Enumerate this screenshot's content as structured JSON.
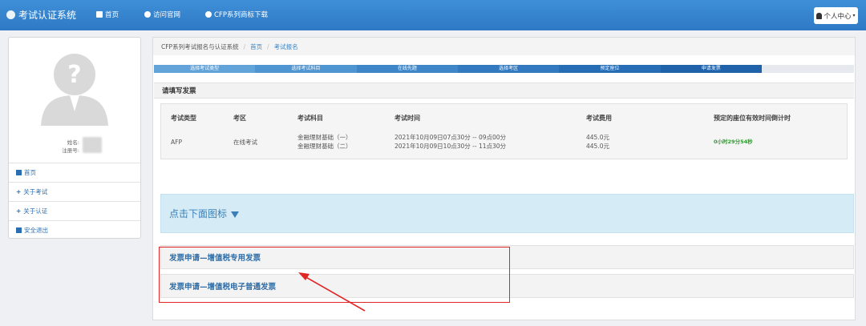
{
  "header": {
    "app_title": "考试认证系统",
    "nav": [
      {
        "label": "首页",
        "icon": "home-icon"
      },
      {
        "label": "访问官网",
        "icon": "globe-icon"
      },
      {
        "label": "CFP系列商标下载",
        "icon": "copyright-icon"
      }
    ],
    "user_menu": "个人中心"
  },
  "sidebar": {
    "name_label": "姓名:",
    "id_label": "注册号:",
    "menu": [
      {
        "label": "首页",
        "icon": "home-icon"
      },
      {
        "label": "关于考试",
        "icon": "plus-icon"
      },
      {
        "label": "关于认证",
        "icon": "plus-icon"
      },
      {
        "label": "安全退出",
        "icon": "lock-icon"
      }
    ]
  },
  "breadcrumb": [
    "CFP系列考试报名与认证系统",
    "首页",
    "考试报名"
  ],
  "steps": [
    {
      "label": "选择考试类型",
      "color": "#62a3da"
    },
    {
      "label": "选择考试科目",
      "color": "#4f95d2"
    },
    {
      "label": "在线先题",
      "color": "#3f86c8"
    },
    {
      "label": "选择考区",
      "color": "#3279bf"
    },
    {
      "label": "预定座位",
      "color": "#276db5"
    },
    {
      "label": "申请发票",
      "color": "#1f62aa"
    }
  ],
  "section_title": "请填写发票",
  "table": {
    "headers": [
      "考试类型",
      "考区",
      "考试科目",
      "考试时间",
      "考试费用",
      "预定的座位有效时间倒计时"
    ],
    "row": {
      "type": "AFP",
      "area": "在线考试",
      "subjects": [
        "金融理财基础（一）",
        "金融理财基础（二）"
      ],
      "times": [
        "2021年10月09日07点30分 -- 09点00分",
        "2021年10月09日10点30分 -- 11点30分"
      ],
      "fees": [
        "445.0元",
        "445.0元"
      ],
      "countdown": "0小时29分54秒"
    }
  },
  "hint": "点击下面图标",
  "invoice_options": [
    "发票申请—增值税专用发票",
    "发票申请—增值税电子普通发票"
  ],
  "colors": {
    "accent": "#2f79c4",
    "highlight": "#e02525",
    "countdown": "#2e9a2e"
  }
}
